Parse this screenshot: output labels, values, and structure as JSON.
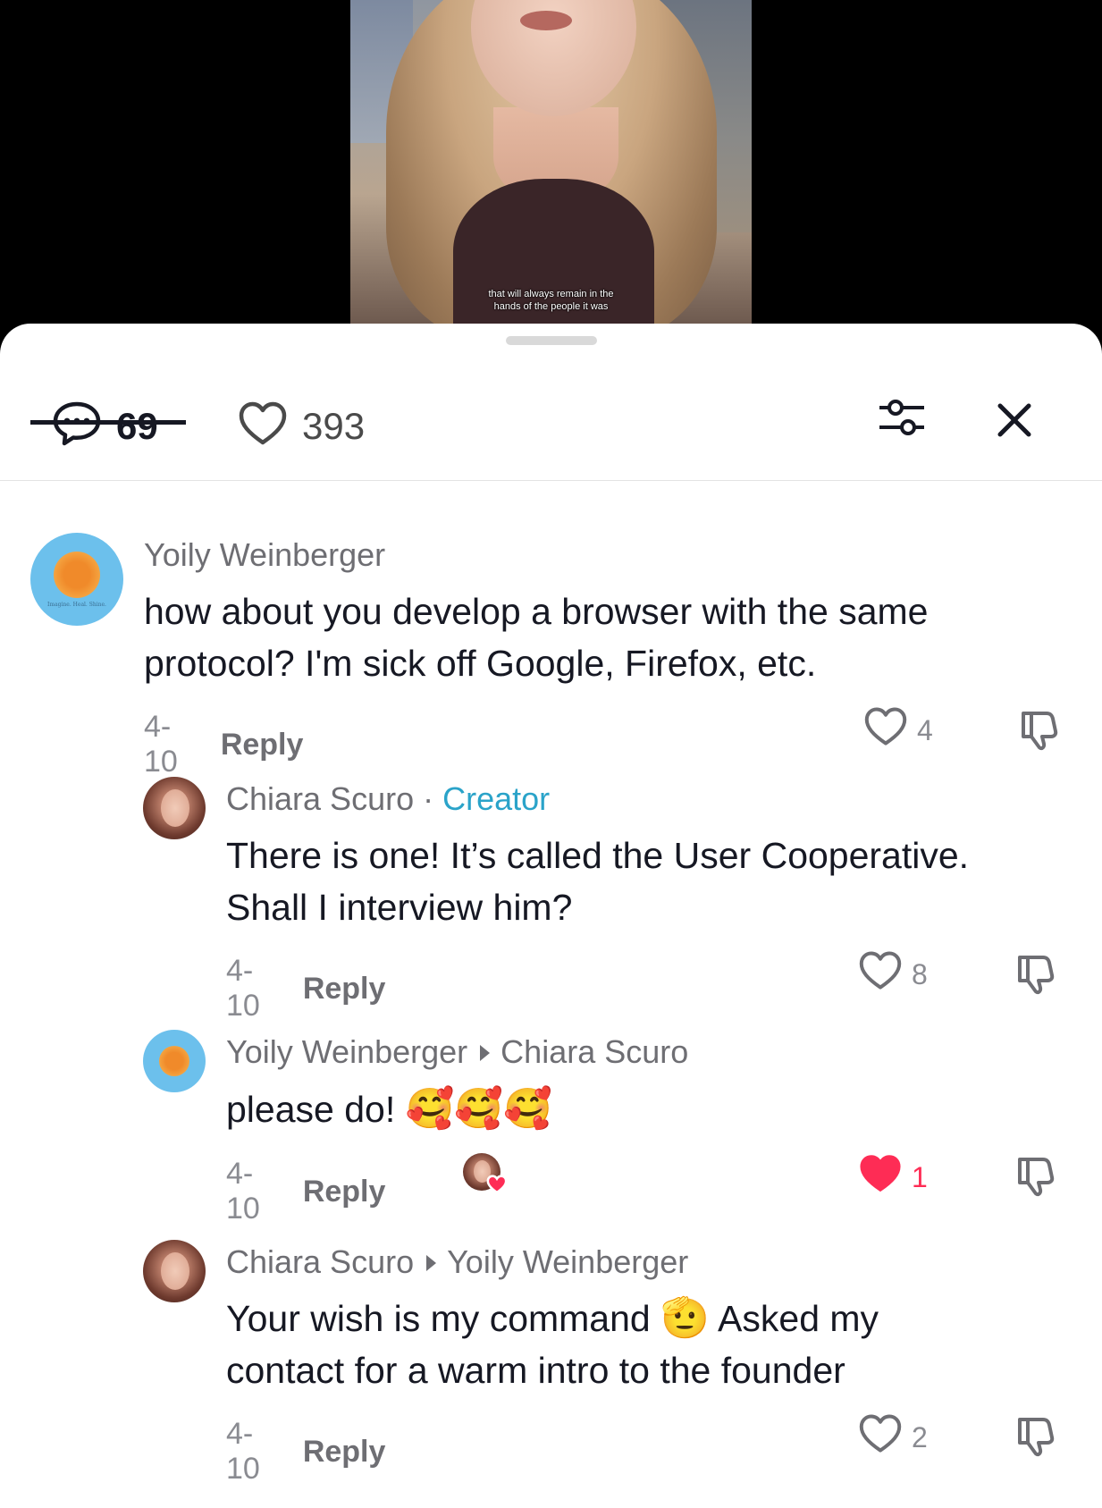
{
  "video": {
    "caption_line1": "that will always remain in the",
    "caption_line2": "hands of the people it was"
  },
  "tabs": {
    "comments_count": "69",
    "likes_count": "393"
  },
  "comments": [
    {
      "author": "Yoily Weinberger",
      "text_line1": "how about you develop a browser with the same",
      "text_line2": "protocol? I'm sick off Google, Firefox, etc.",
      "date": "4-10",
      "reply_label": "Reply",
      "likes": "4",
      "liked": false,
      "avatar": "sun-logo-avatar",
      "avatar_tagline": "Imagine. Heal. Shine."
    },
    {
      "author": "Chiara Scuro",
      "separator": "·",
      "badge": "Creator",
      "text_line1": "There is one! It’s called the User Cooperative.",
      "text_line2": "Shall I interview him?",
      "date": "4-10",
      "reply_label": "Reply",
      "likes": "8",
      "liked": false,
      "avatar": "woman-portrait-avatar"
    },
    {
      "author": "Yoily Weinberger",
      "reply_to": "Chiara Scuro",
      "text": "please do!",
      "emoji": "🥰🥰🥰",
      "date": "4-10",
      "reply_label": "Reply",
      "likes": "1",
      "liked": true,
      "liked_by_creator": true,
      "avatar": "sun-logo-avatar"
    },
    {
      "author": "Chiara Scuro",
      "reply_to": "Yoily Weinberger",
      "text_part1": "Your wish is my command",
      "emoji": "🫡",
      "text_part2": "Asked my",
      "text_line2": "contact for a warm intro to the founder",
      "date": "4-10",
      "reply_label": "Reply",
      "likes": "2",
      "liked": false,
      "avatar": "woman-portrait-avatar"
    }
  ],
  "colors": {
    "accent_creator": "#2aa3c9",
    "like_active": "#fe2c55",
    "text_primary": "#161823",
    "text_secondary": "#6e6e73"
  },
  "icons": {
    "comments_tab": "comment-bubble-icon",
    "likes_tab": "heart-outline-icon",
    "filter": "sliders-icon",
    "close": "close-icon",
    "dislike": "thumbs-down-icon"
  }
}
